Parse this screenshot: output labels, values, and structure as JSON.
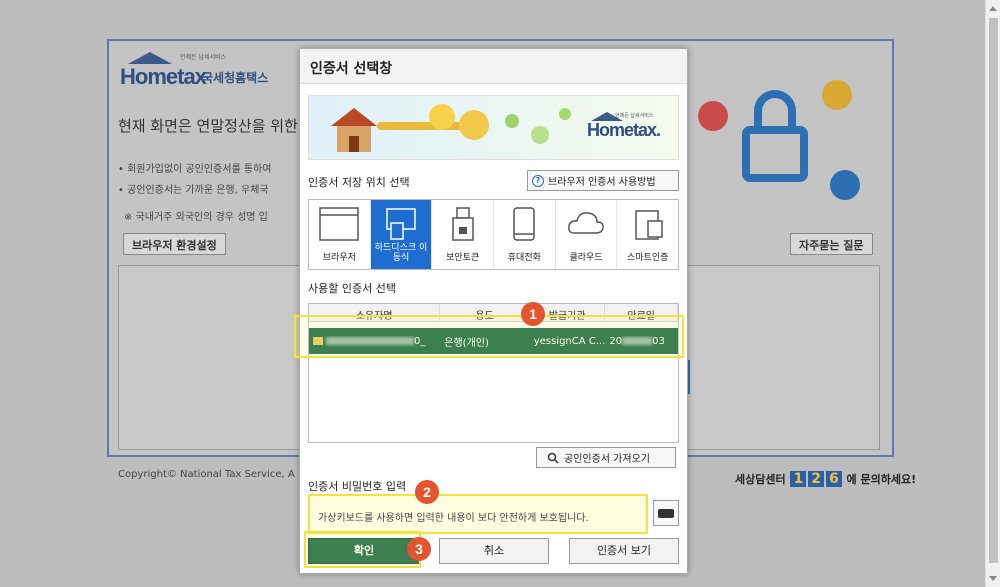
{
  "background": {
    "logo_word": "Hometax",
    "logo_kor": "국세청홈택스",
    "logo_tiny": "언제든 납세서비스",
    "headline": "현재 화면은 연말정산을 위한 ...",
    "bullets": [
      "• 회원가입없이 공인인증서를 통하여",
      "• 공인인증서는 가까운 은행, 우체국",
      "※ 국내거주 외국인의 경우 성명 입"
    ],
    "browser_settings_label": "브라우저 환경설정",
    "faq_label": "자주묻는 질문",
    "copyright": "Copyright© National Tax Service, A",
    "call_center_prefix": "세상담센터",
    "call_center_number": [
      "1",
      "2",
      "6"
    ],
    "call_center_suffix": "에 문의하세요!"
  },
  "dialog": {
    "title": "인증서 선택창",
    "banner_logo": "Hometax.",
    "banner_tiny": "언제든 납세서비스",
    "storage_label": "인증서 저장 위치 선택",
    "help_button": "브라우저 인증서 사용방법",
    "storage_options": [
      {
        "label": "브라우저",
        "icon": "browser-icon",
        "active": false
      },
      {
        "label": "하드디스크 이동식",
        "icon": "usb-drive-icon",
        "active": true
      },
      {
        "label": "보안토큰",
        "icon": "security-token-icon",
        "active": false
      },
      {
        "label": "휴대전화",
        "icon": "mobile-phone-icon",
        "active": false
      },
      {
        "label": "클라우드",
        "icon": "cloud-icon",
        "active": false
      },
      {
        "label": "스마트인증",
        "icon": "smart-auth-icon",
        "active": false
      }
    ],
    "cert_label": "사용할 인증서 선택",
    "columns": [
      "소유자명",
      "용도",
      "발급기관",
      "만료일"
    ],
    "cert_row": {
      "owner_suffix": "0_",
      "use": "은행(개인)",
      "issuer": "yessignCA C...",
      "expire_prefix": "20",
      "expire_suffix": "03"
    },
    "import_button": "공인인증서 가져오기",
    "password_label": "인증서 비밀번호 입력",
    "password_placeholder": "가상키보드를 사용하면 입력한 내용이 보다 안전하게 보호됩니다.",
    "confirm_button": "확인",
    "cancel_button": "취소",
    "view_button": "인증서 보기"
  },
  "markers": [
    "1",
    "2",
    "3"
  ],
  "colors": {
    "accent_green": "#1b6a4a",
    "active_blue": "#1d6ed0",
    "highlight_yellow": "#f2e23a",
    "marker_red": "#e4552f"
  }
}
